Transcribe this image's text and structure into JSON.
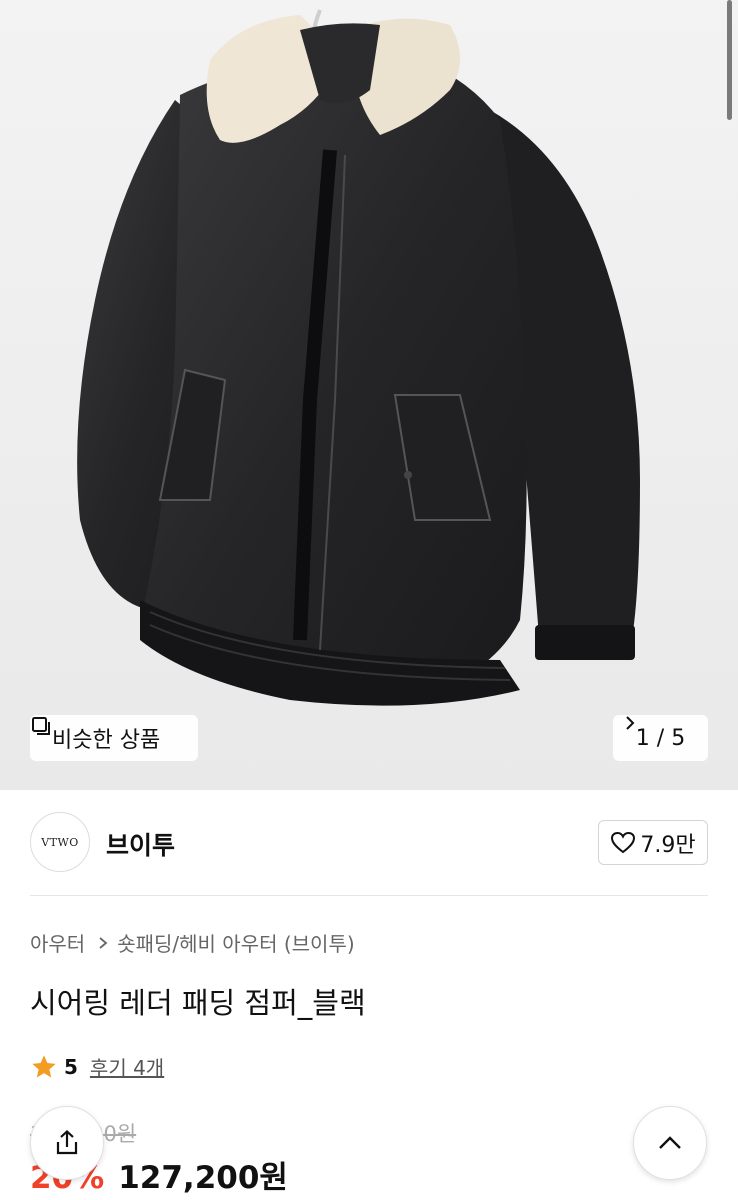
{
  "gallery": {
    "image_alt": "시어링 레더 패딩 점퍼_블랙",
    "similar_label": "비슷한 상품",
    "similar_icon": "copy-square-icon",
    "counter": "1 / 5",
    "next_icon": "chevron-right-icon"
  },
  "brand": {
    "logo_text": "VTWO",
    "name": "브이투",
    "likes": "7.9만",
    "like_icon": "heart-outline-icon"
  },
  "breadcrumb": {
    "items": [
      "아우터",
      "숏패딩/헤비 아우터 (브이투)"
    ]
  },
  "product": {
    "title": "시어링 레더 패딩 점퍼_블랙",
    "rating": "5",
    "reviews": "후기 4개",
    "original_price": "159,000원",
    "discount": "20%",
    "sale_price": "127,200원"
  },
  "colors": {
    "accent": "#f0412b",
    "star": "#f39c22",
    "hero_bg": "#efefef"
  },
  "actions": {
    "share_icon": "share-icon",
    "top_icon": "chevron-up-icon"
  }
}
